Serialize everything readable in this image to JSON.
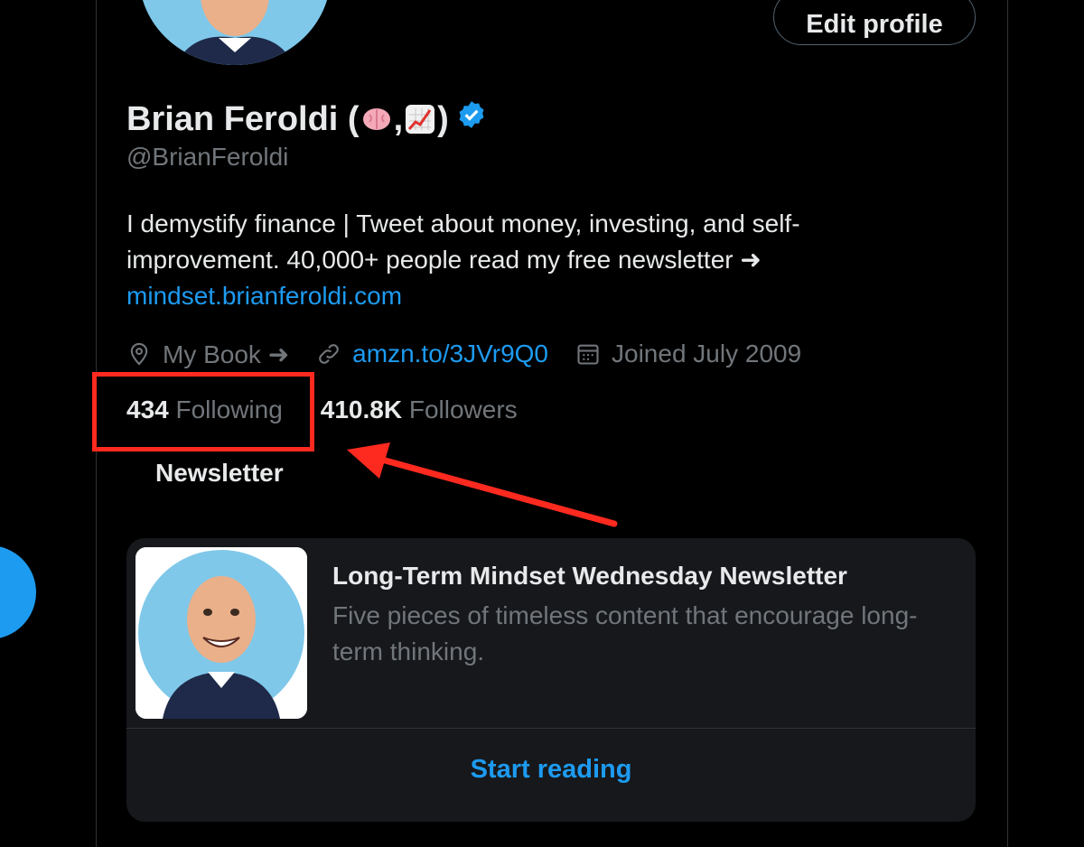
{
  "profile": {
    "edit_button": "Edit profile",
    "name": "Brian Feroldi (",
    "name_sep": ",",
    "name_end": ")",
    "handle": "@BrianFeroldi",
    "bio_text": "I demystify finance | Tweet about money, investing, and self-improvement. 40,000+ people read my free newsletter ➜",
    "bio_link": "mindset.brianferoldi.com",
    "location": "My Book ➜",
    "website": "amzn.to/3JVr9Q0",
    "joined": "Joined July 2009",
    "following_count": "434",
    "following_label": "Following",
    "followers_count": "410.8K",
    "followers_label": "Followers"
  },
  "newsletter": {
    "heading": "Newsletter",
    "title": "Long-Term Mindset Wednesday Newsletter",
    "description": "Five pieces of timeless content that encourage long-term thinking.",
    "cta": "Start reading"
  },
  "colors": {
    "accent": "#1d9bf0",
    "annotation": "#ff2a1f",
    "background": "#000000"
  },
  "icons": {
    "location": "location-pin-icon",
    "website": "link-icon",
    "joined": "calendar-icon",
    "verified": "verified-badge-icon",
    "emoji1": "brain-emoji-icon",
    "emoji2": "chart-increasing-emoji-icon"
  }
}
